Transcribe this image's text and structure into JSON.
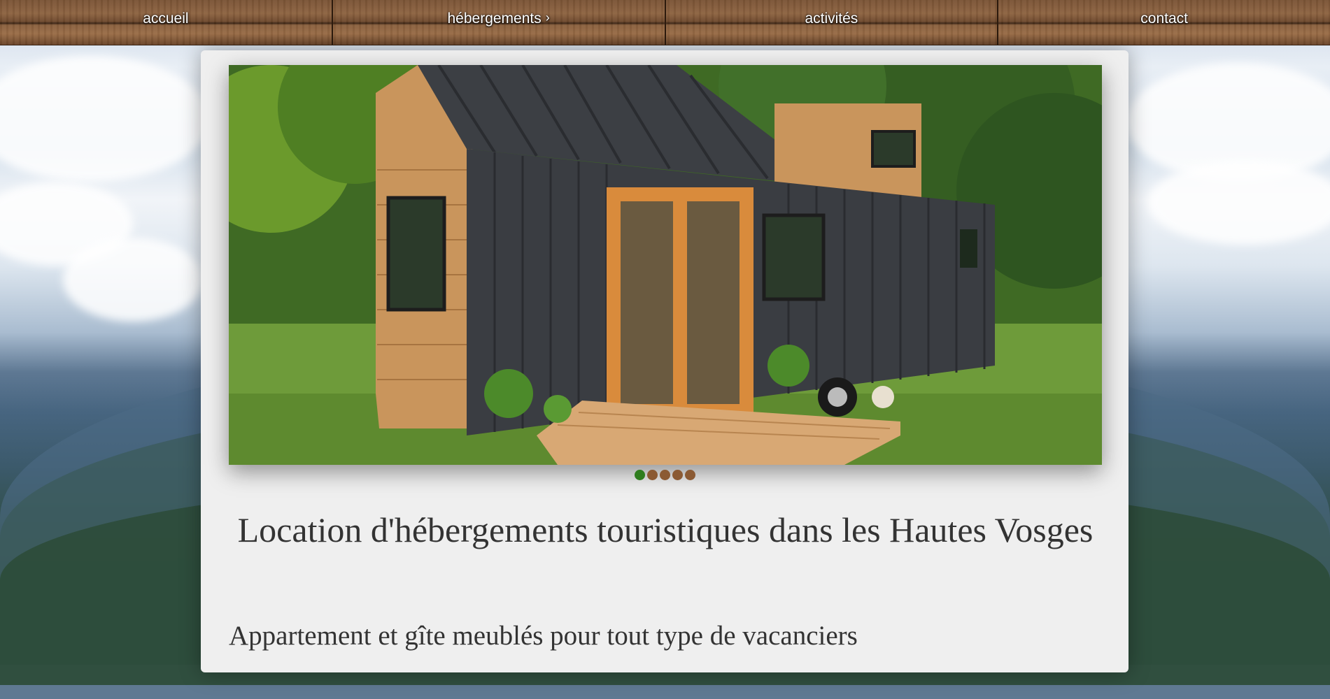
{
  "nav": {
    "items": [
      {
        "label": "accueil"
      },
      {
        "label": "hébergements",
        "chevron": "›"
      },
      {
        "label": "activités"
      },
      {
        "label": "contact"
      }
    ]
  },
  "slider": {
    "image_desc_icon": "tiny-house-photo",
    "dots": 5,
    "active_dot": 0,
    "colors": {
      "active": "#2f7d1e",
      "inactive": "#8b5a33"
    }
  },
  "main": {
    "title": "Location d'hébergements touristiques dans les Hautes Vosges",
    "subtitle": "Appartement et gîte meublés pour tout type de vacanciers"
  }
}
